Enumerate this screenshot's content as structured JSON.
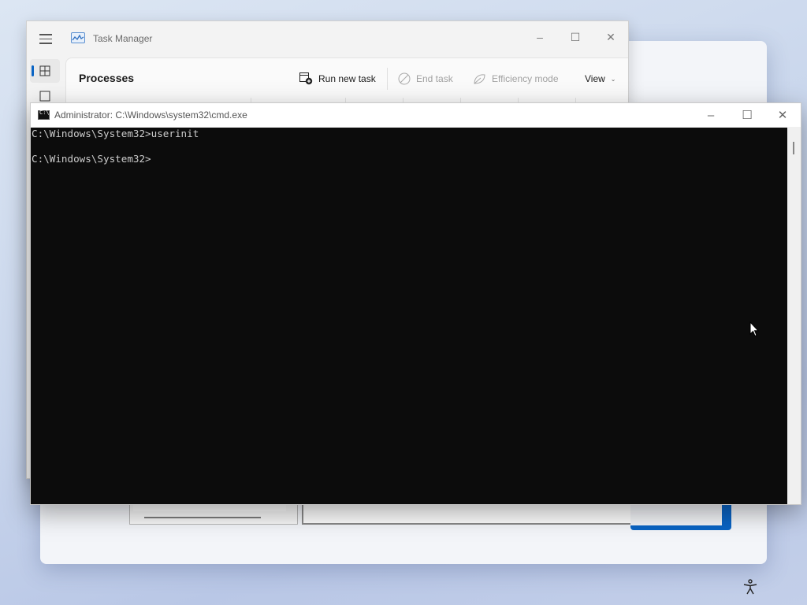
{
  "desktop": {
    "accessibility_icon": "accessibility-icon"
  },
  "task_manager": {
    "title": "Task Manager",
    "app_icon": "task-manager-icon",
    "page_title": "Processes",
    "toolbar": {
      "run_new_task": "Run new task",
      "end_task": "End task",
      "efficiency_mode": "Efficiency mode",
      "view": "View"
    },
    "window_controls": [
      "minimize",
      "maximize",
      "close"
    ]
  },
  "cmd": {
    "title": "Administrator: C:\\Windows\\system32\\cmd.exe",
    "lines": [
      "C:\\Windows\\System32>userinit",
      "",
      "C:\\Windows\\System32>"
    ]
  },
  "colors": {
    "console_bg": "#0c0c0c",
    "console_text": "#cccccc",
    "accent": "#0a64c4"
  }
}
